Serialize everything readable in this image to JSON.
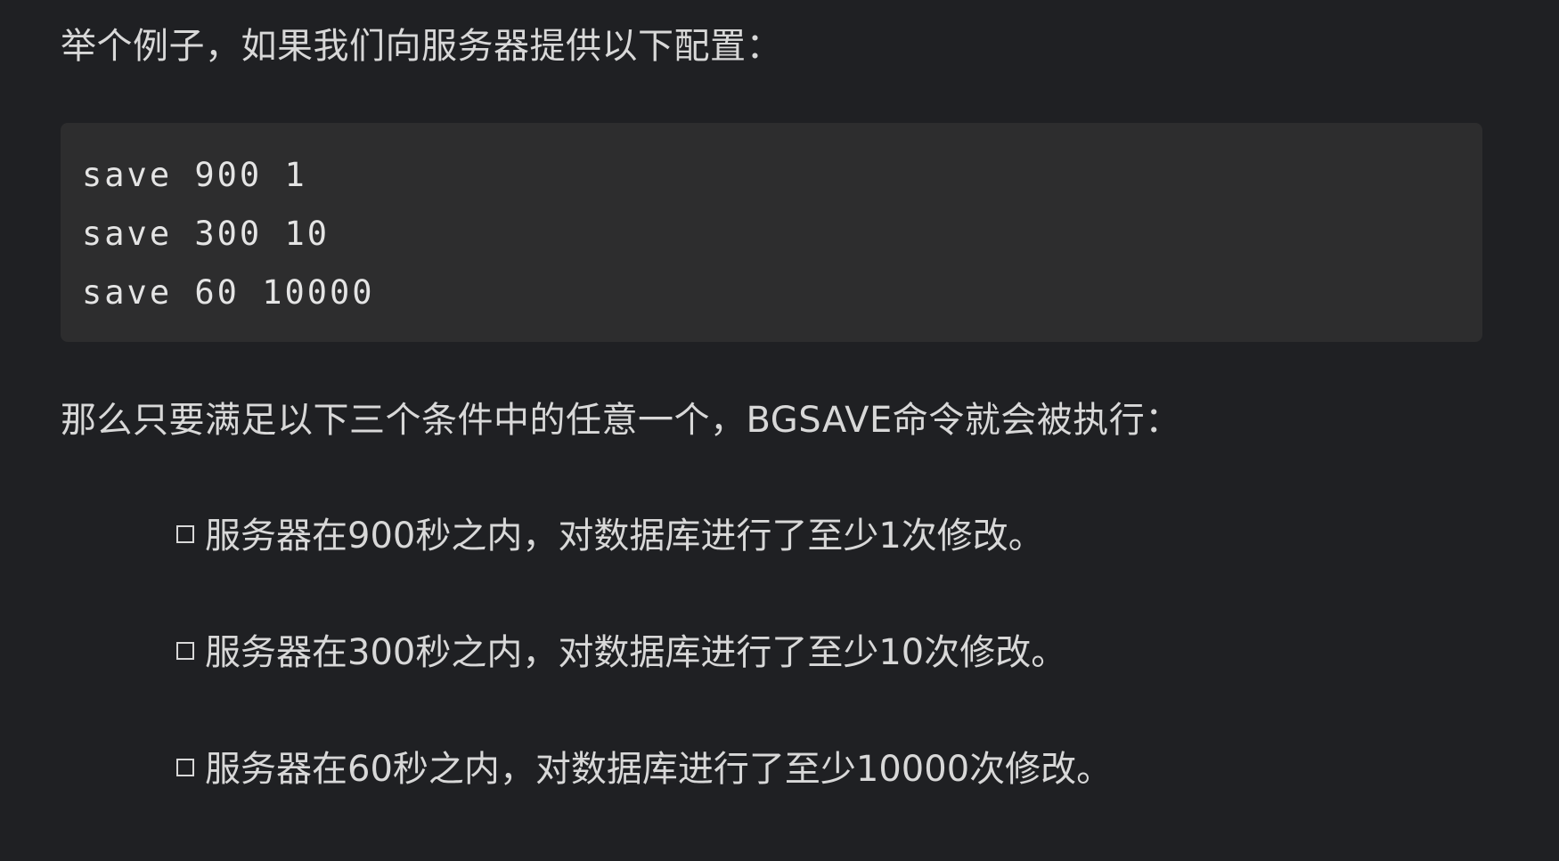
{
  "intro_text": "举个例子，如果我们向服务器提供以下配置：",
  "code_lines": [
    "save 900 1",
    "save 300 10",
    "save 60 10000"
  ],
  "lead_text": "那么只要满足以下三个条件中的任意一个，BGSAVE命令就会被执行：",
  "conditions": [
    "服务器在900秒之内，对数据库进行了至少1次修改。",
    "服务器在300秒之内，对数据库进行了至少10次修改。",
    "服务器在60秒之内，对数据库进行了至少10000次修改。"
  ],
  "bullet_icon": "checkbox-icon",
  "colors": {
    "background": "#1f2023",
    "code_background": "#2d2d2e",
    "text": "#d8d8d8"
  }
}
